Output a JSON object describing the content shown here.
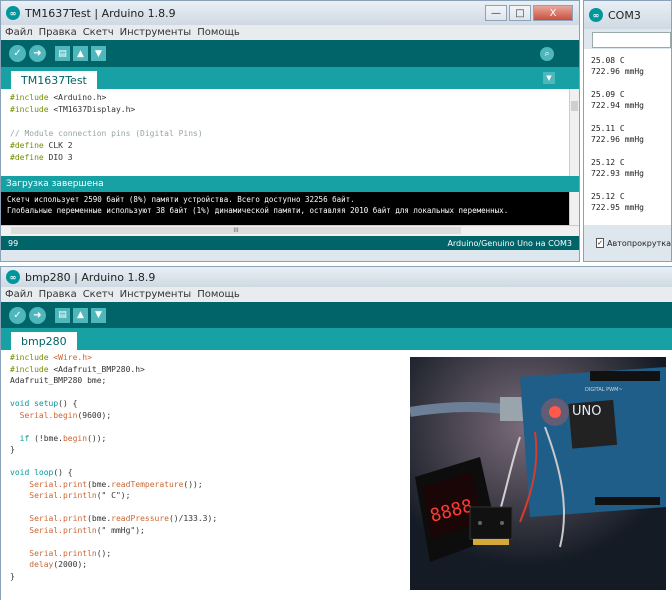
{
  "window1": {
    "title": "TM1637Test | Arduino 1.8.9",
    "controls": {
      "minimize": "—",
      "maximize": "□",
      "close": "X"
    },
    "menu": [
      "Файл",
      "Правка",
      "Скетч",
      "Инструменты",
      "Помощь"
    ],
    "tab": "TM1637Test",
    "code": [
      {
        "p": "#include",
        "q": " <Arduino.h>"
      },
      {
        "p": "#include",
        "q": " <TM1637Display.h>"
      },
      {
        "p": "",
        "q": ""
      },
      {
        "p": "",
        "q": "// Module connection pins (Digital Pins)"
      },
      {
        "p": "#define",
        "q": " CLK 2"
      },
      {
        "p": "#define",
        "q": " DIO 3"
      }
    ],
    "status": "Загрузка завершена",
    "console": [
      "Скетч использует 2590 байт (8%) памяти устройства. Всего доступно 32256 байт.",
      "Глобальные переменные используют 38 байт (1%) динамической памяти, оставляя 2010 байт для локальных переменных."
    ],
    "scroll_marker": "III",
    "footer_left": "99",
    "footer_right": "Arduino/Genuino Uno на COM3"
  },
  "window_com3": {
    "title": "COM3",
    "readings": [
      {
        "temp": "25.08 C",
        "pressure": "722.96 mmHg"
      },
      {
        "temp": "25.09 C",
        "pressure": "722.94 mmHg"
      },
      {
        "temp": "25.11 C",
        "pressure": "722.96 mmHg"
      },
      {
        "temp": "25.12 C",
        "pressure": "722.93 mmHg"
      },
      {
        "temp": "25.12 C",
        "pressure": "722.95 mmHg"
      }
    ],
    "autoscroll_label": "Автопрокрутка"
  },
  "window2": {
    "title": "bmp280 | Arduino 1.8.9",
    "menu": [
      "Файл",
      "Правка",
      "Скетч",
      "Инструменты",
      "Помощь"
    ],
    "tab": "bmp280",
    "code": {
      "l1a": "#include",
      "l1b": " <Wire.h>",
      "l2a": "#include",
      "l2b": " <Adafruit_BMP280.h>",
      "l3": "Adafruit_BMP280 bme;",
      "l5a": "void",
      "l5b": " setup",
      "l5c": "() {",
      "l6a": "  Serial",
      "l6b": ".begin",
      "l6c": "(9600);",
      "l8a": "  if",
      "l8b": " (!bme.",
      "l8c": "begin",
      "l8d": "());",
      "l9": "}",
      "l11a": "void",
      "l11b": " loop",
      "l11c": "() {",
      "l12a": "    Serial",
      "l12b": ".print",
      "l12c": "(bme.",
      "l12d": "readTemperature",
      "l12e": "());",
      "l13a": "    Serial",
      "l13b": ".println",
      "l13c": "(\" C\");",
      "l15a": "    Serial",
      "l15b": ".print",
      "l15c": "(bme.",
      "l15d": "readPressure",
      "l15e": "()/133.3);",
      "l16a": "    Serial",
      "l16b": ".println",
      "l16c": "(\" mmHg\");",
      "l18a": "    Serial",
      "l18b": ".println",
      "l18c": "();",
      "l19a": "    delay",
      "l19b": "(2000);",
      "l20": "}"
    },
    "board_label_model": "UNO",
    "board_label_top": "DIGITAL PWM~"
  },
  "colors": {
    "arduino_dark": "#006468",
    "arduino_mid": "#17a1a5",
    "arduino_light": "#4db7bb"
  }
}
